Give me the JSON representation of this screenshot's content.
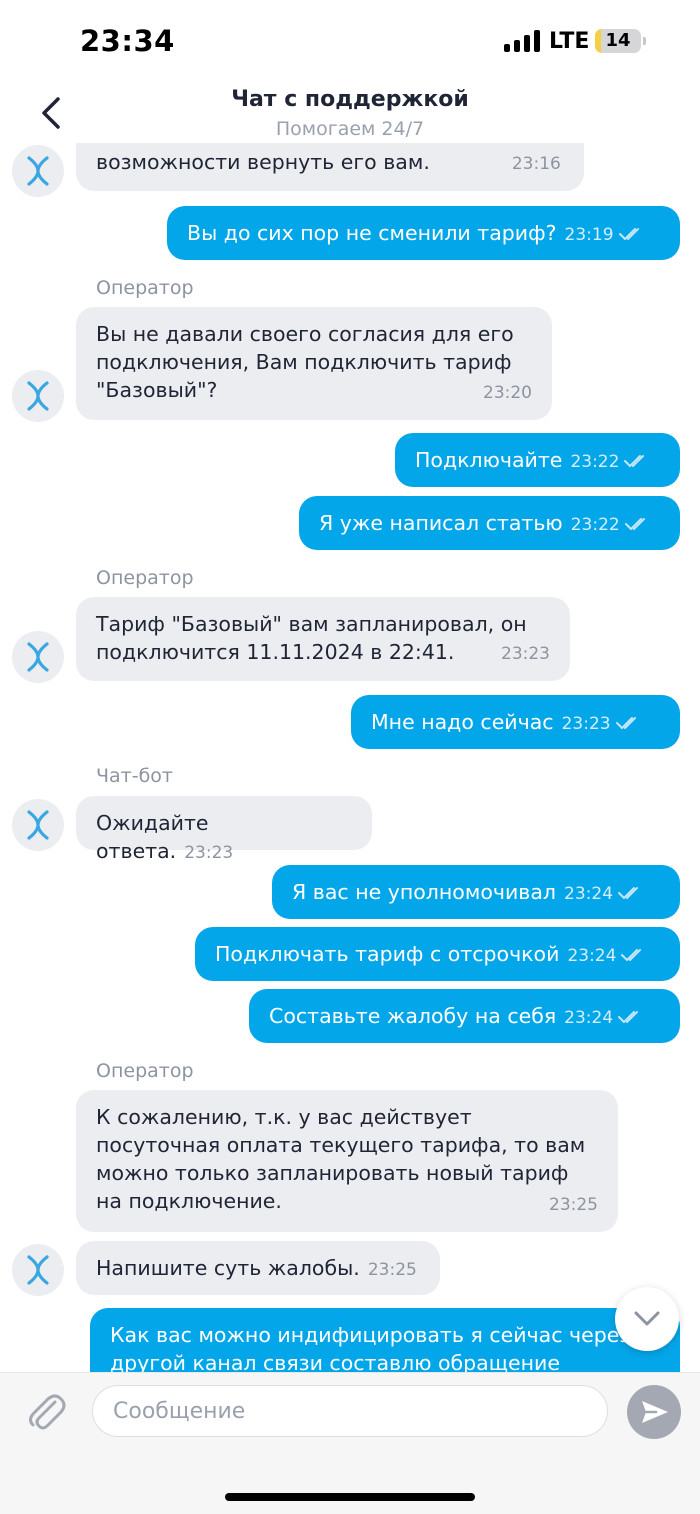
{
  "status_bar": {
    "time": "23:34",
    "network": "LTE",
    "battery": "14",
    "battery_level": 0.14
  },
  "header": {
    "title": "Чат с поддержкой",
    "subtitle": "Помогаем 24/7"
  },
  "messages": [
    {
      "side": "in",
      "text": "возможности вернуть его вам.",
      "time": "23:16"
    },
    {
      "side": "out",
      "text": "Вы до сих пор не сменили тариф?",
      "time": "23:19"
    },
    {
      "sender": "Оператор"
    },
    {
      "side": "in",
      "text": "Вы не давали своего согласия для его подключения, Вам подключить тариф \"Базовый\"?",
      "time": "23:20"
    },
    {
      "side": "out",
      "text": "Подключайте",
      "time": "23:22"
    },
    {
      "side": "out",
      "text": "Я уже написал статью",
      "time": "23:22"
    },
    {
      "sender": "Оператор"
    },
    {
      "side": "in",
      "text": "Тариф \"Базовый\" вам запланировал, он подключится 11.11.2024 в 22:41.",
      "time": "23:23"
    },
    {
      "side": "out",
      "text": "Мне надо сейчас",
      "time": "23:23"
    },
    {
      "sender": "Чат-бот"
    },
    {
      "side": "in",
      "text": "Ожидайте ответа.",
      "time": "23:23"
    },
    {
      "side": "out",
      "text": "Я вас не уполномочивал",
      "time": "23:24"
    },
    {
      "side": "out",
      "text": "Подключать тариф с отсрочкой",
      "time": "23:24"
    },
    {
      "side": "out",
      "text": "Составьте жалобу на себя",
      "time": "23:24"
    },
    {
      "sender": "Оператор"
    },
    {
      "side": "in",
      "text": "К сожалению, т.к. у вас действует посуточная оплата текущего тарифа, то вам можно только запланировать новый тариф на подключение.",
      "time": "23:25"
    },
    {
      "side": "in",
      "text": "Напишите суть жалобы.",
      "time": "23:25"
    },
    {
      "side": "out",
      "text": "Как вас можно индифицировать  я сейчас через другой канал связи составлю обращение"
    }
  ],
  "composer": {
    "placeholder": "Сообщение"
  },
  "colors": {
    "accent": "#04a6ea",
    "incoming_bubble": "#ecedf1",
    "send_button": "#a3a8b2"
  },
  "icons": [
    "back-icon",
    "paperclip-icon",
    "send-icon",
    "chevron-down-icon",
    "bot-avatar-icon",
    "double-check-icon"
  ]
}
